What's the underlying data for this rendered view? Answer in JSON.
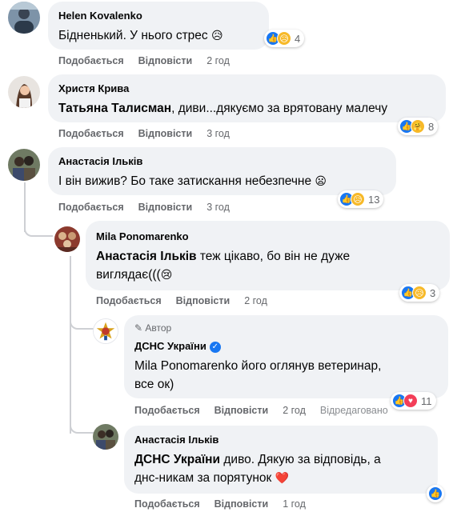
{
  "comments": [
    {
      "author": "Helen Kovalenko",
      "text": "Бідненький. У нього стрес",
      "emoji": "😥",
      "actions": {
        "like": "Подобається",
        "reply": "Відповісти",
        "time": "2 год"
      },
      "reactions": {
        "icons": [
          "like-icon",
          "sad-icon"
        ],
        "count": "4"
      }
    },
    {
      "author": "Христя Крива",
      "mention": "Татьяна Талисман",
      "text": ", диви...дякуємо за врятовану малечу",
      "actions": {
        "like": "Подобається",
        "reply": "Відповісти",
        "time": "3 год"
      },
      "reactions": {
        "icons": [
          "like-icon",
          "care-icon"
        ],
        "count": "8"
      }
    },
    {
      "author": "Анастасія Ільків",
      "text": "І він вижив? Бо таке затискання небезпечне",
      "emoji": "😦",
      "actions": {
        "like": "Подобається",
        "reply": "Відповісти",
        "time": "3 год"
      },
      "reactions": {
        "icons": [
          "like-icon",
          "sad-icon"
        ],
        "count": "13"
      }
    },
    {
      "author": "Mila Ponomarenko",
      "mention": "Анастасія Ільків",
      "text_line1": " теж цікаво, бо він не дуже",
      "text_line2": "виглядає(((",
      "emoji": "😢",
      "actions": {
        "like": "Подобається",
        "reply": "Відповісти",
        "time": "2 год"
      },
      "reactions": {
        "icons": [
          "like-icon",
          "sad-icon"
        ],
        "count": "3"
      }
    },
    {
      "author_tag": "Автор",
      "author": "ДСНС України",
      "text_line1": "Mila Ponomarenko його оглянув ветеринар,",
      "text_line2": "все ок)",
      "actions": {
        "like": "Подобається",
        "reply": "Відповісти",
        "time": "2 год",
        "edited": "Відредаговано"
      },
      "reactions": {
        "icons": [
          "like-icon",
          "heart-icon"
        ],
        "count": "11"
      }
    },
    {
      "author": "Анастасія Ільків",
      "mention": "ДСНС України",
      "text_line1": " диво. Дякую за відповідь, а",
      "text_line2": "днс-никам за порятунок",
      "emoji": "❤️",
      "actions": {
        "like": "Подобається",
        "reply": "Відповісти",
        "time": "1 год"
      },
      "reactions": {
        "icons": [
          "like-icon"
        ],
        "count": ""
      }
    }
  ],
  "colors": {
    "like": "#1877f2",
    "sad": "#f7b928",
    "heart": "#f33e58",
    "bubble": "#f0f2f5",
    "meta": "#65676b"
  }
}
